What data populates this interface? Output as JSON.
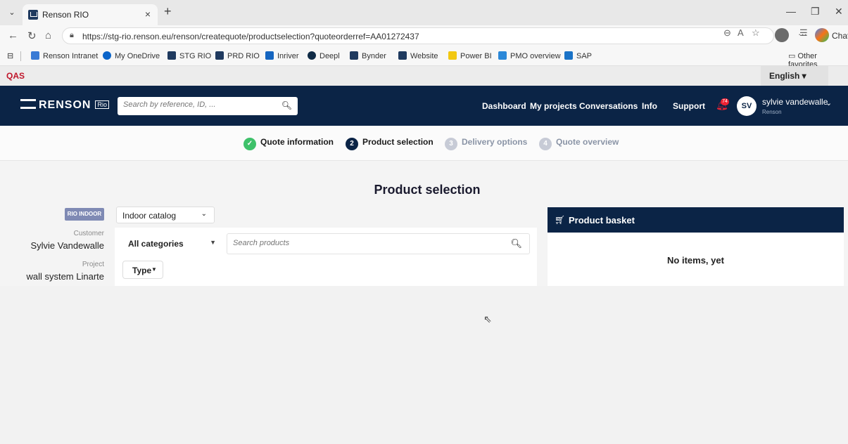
{
  "browser": {
    "tab_title": "Renson RIO",
    "tab_close": "×",
    "new_tab": "+",
    "url": "https://stg-rio.renson.eu/renson/createquote/productselection?quoteorderref=AA01272437",
    "chat_label": "Chat",
    "favorites": [
      {
        "label": "Renson Intranet",
        "color": "#3a7bd5"
      },
      {
        "label": "My OneDrive",
        "color": "#0a64c9"
      },
      {
        "label": "STG RIO",
        "color": "#1f3a5f"
      },
      {
        "label": "PRD RIO",
        "color": "#1f3a5f"
      },
      {
        "label": "Inriver",
        "color": "#1565c0"
      },
      {
        "label": "Deepl",
        "color": "#0f2b46"
      },
      {
        "label": "Bynder",
        "color": "#1f3a5f"
      },
      {
        "label": "Website",
        "color": "#1f3a5f"
      },
      {
        "label": "Power BI",
        "color": "#f2c811"
      },
      {
        "label": "PMO overview",
        "color": "#2b88d8"
      },
      {
        "label": "SAP",
        "color": "#1a73c7"
      }
    ],
    "other_favorites": "Other favorites"
  },
  "env": {
    "label": "QAS",
    "language": "English ▾"
  },
  "nav": {
    "logo": "RENSON",
    "logo_sub": "Rio",
    "search_placeholder": "Search by reference, ID, ...",
    "links": [
      "Dashboard",
      "My projects",
      "Conversations",
      "Info",
      "Support"
    ],
    "notification_count": "74",
    "user_initials": "SV",
    "user_name": "sylvie vandewalle",
    "user_org": "Renson"
  },
  "steps": [
    {
      "num": "✓",
      "label": "Quote information",
      "state": "done"
    },
    {
      "num": "2",
      "label": "Product selection",
      "state": "active"
    },
    {
      "num": "3",
      "label": "Delivery options",
      "state": "todo"
    },
    {
      "num": "4",
      "label": "Quote overview",
      "state": "todo"
    }
  ],
  "page": {
    "title": "Product selection",
    "badge": "RIO INDOOR",
    "customer_label": "Customer",
    "customer_value": "Sylvie Vandewalle",
    "project_label": "Project",
    "project_value": "wall system Linarte",
    "catalog": "Indoor catalog",
    "category": "All categories",
    "product_search_placeholder": "Search products",
    "type_filter": "Type"
  },
  "basket": {
    "title": "Product basket",
    "empty": "No items, yet"
  },
  "colors": {
    "navy": "#0b2446",
    "qas_red": "#c0162b",
    "step_done": "#3ec16a"
  }
}
